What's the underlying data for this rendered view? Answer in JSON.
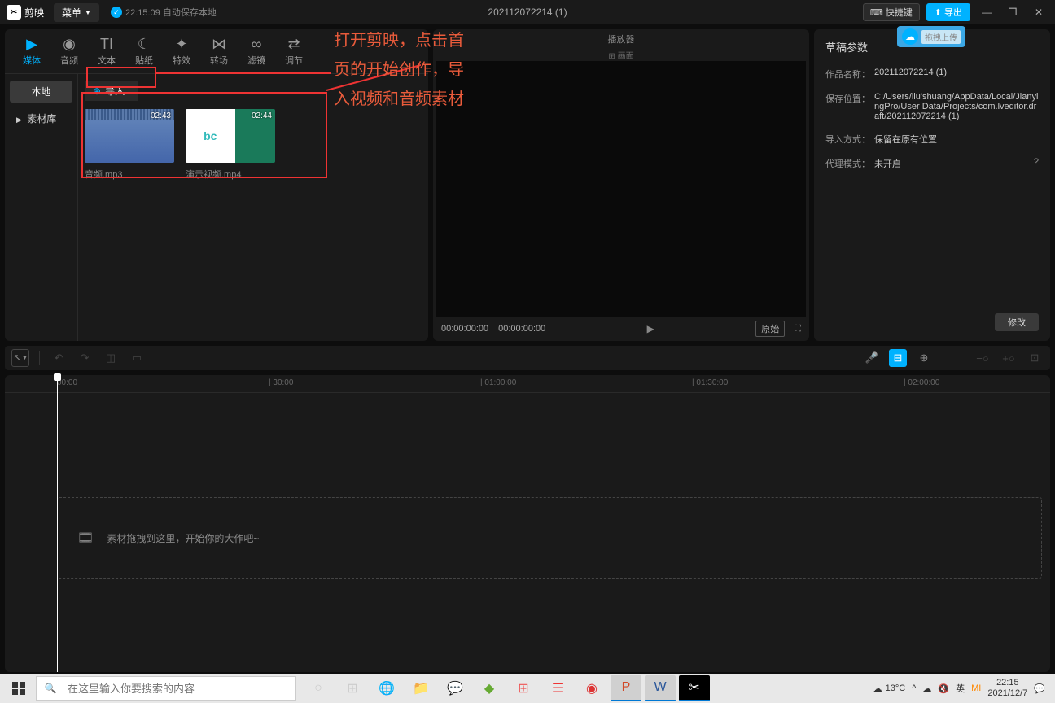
{
  "titlebar": {
    "app_name": "剪映",
    "menu": "菜单",
    "autosave": "22:15:09 自动保存本地",
    "project_title": "202112072214 (1)",
    "keyboard": "快捷键",
    "export": "导出",
    "cloud_upload": "拖拽上传"
  },
  "annotation": {
    "line1": "打开剪映，点击首",
    "line2": "页的开始创作，导",
    "line3": "入视频和音频素材"
  },
  "top_tabs": [
    {
      "icon": "▶",
      "label": "媒体"
    },
    {
      "icon": "◉",
      "label": "音频"
    },
    {
      "icon": "TI",
      "label": "文本"
    },
    {
      "icon": "☾",
      "label": "贴纸"
    },
    {
      "icon": "✦",
      "label": "特效"
    },
    {
      "icon": "⋈",
      "label": "转场"
    },
    {
      "icon": "∞",
      "label": "滤镜"
    },
    {
      "icon": "⇄",
      "label": "调节"
    }
  ],
  "media_sidebar": {
    "local": "本地",
    "library": "素材库"
  },
  "import_btn": "导入",
  "media_items": [
    {
      "name": "音频.mp3",
      "duration": "02:43"
    },
    {
      "name": "演示视频.mp4",
      "duration": "02:44"
    }
  ],
  "preview": {
    "title": "播放器",
    "ratio_label": "画面",
    "time_current": "00:00:00:00",
    "time_total": "00:00:00:00",
    "original": "原始"
  },
  "props": {
    "title": "草稿参数",
    "name_label": "作品名称：",
    "name_value": "202112072214 (1)",
    "path_label": "保存位置：",
    "path_value": "C:/Users/liu'shuang/AppData/Local/JianyingPro/User Data/Projects/com.lveditor.draft/202112072214 (1)",
    "import_label": "导入方式：",
    "import_value": "保留在原有位置",
    "proxy_label": "代理模式：",
    "proxy_value": "未开启",
    "modify": "修改"
  },
  "ruler_marks": [
    "00:00",
    "| 30:00",
    "| 01:00:00",
    "| 01:30:00",
    "| 02:00:00"
  ],
  "timeline_drop": "素材拖拽到这里，开始你的大作吧~",
  "taskbar": {
    "search_placeholder": "在这里输入你要搜索的内容",
    "weather_temp": "13°C",
    "ime": "英",
    "time": "22:15",
    "date": "2021/12/7"
  }
}
